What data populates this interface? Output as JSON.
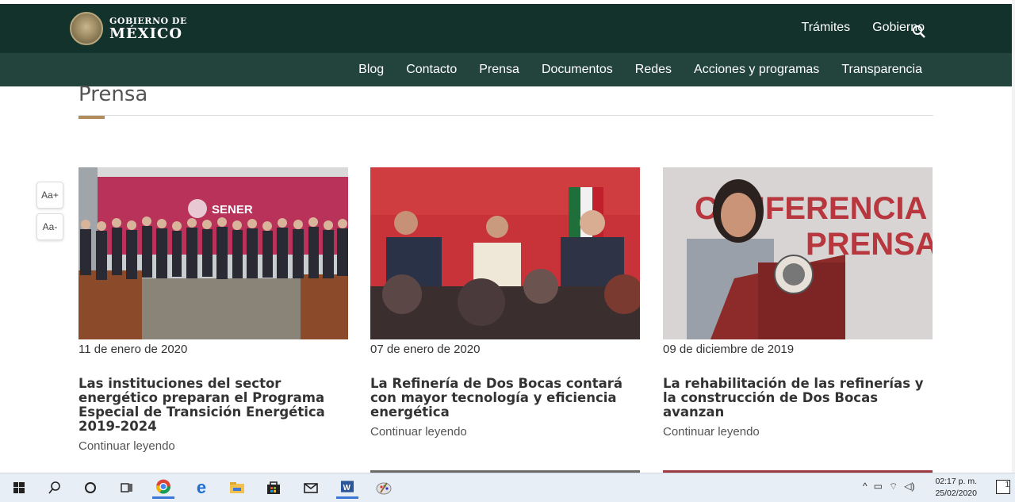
{
  "brand": {
    "line1": "GOBIERNO DE",
    "line2": "MÉXICO"
  },
  "top_links": [
    "Trámites",
    "Gobierno"
  ],
  "nav": [
    "Blog",
    "Contacto",
    "Prensa",
    "Documentos",
    "Redes",
    "Acciones y programas",
    "Transparencia"
  ],
  "page_title": "Prensa",
  "font_controls": {
    "increase": "Aa+",
    "decrease": "Aa-"
  },
  "cards": [
    {
      "date": "11 de enero de 2020",
      "title": "Las instituciones del sector energético preparan el Programa Especial de Transición Energética 2019-2024",
      "link": "Continuar leyendo",
      "sign_text": "SENER"
    },
    {
      "date": "07 de enero de 2020",
      "title": "La Refinería de Dos Bocas contará con mayor tecnología y eficiencia energética",
      "link": "Continuar leyendo"
    },
    {
      "date": "09 de diciembre de 2019",
      "title": "La rehabilitación de las refinerías y la construcción de Dos Bocas avanzan",
      "link": "Continuar leyendo",
      "banner_line1": "CONFERENCIA",
      "banner_line2": "PRENSA"
    }
  ],
  "taskbar": {
    "time": "02:17 p. m.",
    "date": "25/02/2020",
    "notifications": "1"
  },
  "colors": {
    "header": "#13322b",
    "nav": "#23443c",
    "accent": "#b38e5d"
  }
}
